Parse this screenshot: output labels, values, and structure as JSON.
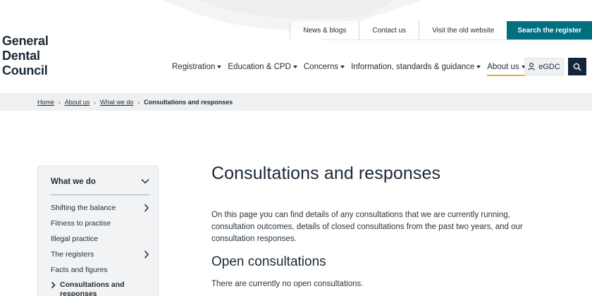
{
  "logo": {
    "line1": "General",
    "line2": "Dental",
    "line3": "Council"
  },
  "utility_nav": {
    "news": "News & blogs",
    "contact": "Contact us",
    "old_site": "Visit the old website",
    "search_register": "Search the register"
  },
  "main_nav": {
    "registration": "Registration",
    "education": "Education & CPD",
    "concerns": "Concerns",
    "info": "Information, standards & guidance",
    "about": "About us",
    "egdc": "eGDC"
  },
  "breadcrumb": {
    "home": "Home",
    "about": "About us",
    "what_we_do": "What we do",
    "current": "Consultations and responses"
  },
  "sidebar": {
    "heading": "What we do",
    "items": [
      "Shifting the balance",
      "Fitness to practise",
      "Illegal practice",
      "The registers",
      "Facts and figures"
    ],
    "current": "Consultations and responses"
  },
  "content": {
    "title": "Consultations and responses",
    "intro": "On this page you can find details of any consultations that we are currently running, consultation outcomes, details of closed consultations from the past two years, and our consultation responses.",
    "open_heading": "Open consultations",
    "open_text": "There are currently no open consultations."
  },
  "colors": {
    "brand_dark": "#12263a",
    "accent_teal": "#006f80",
    "active_underline": "#e8a93a"
  },
  "icons": [
    "user-icon",
    "search-icon",
    "caret-down-icon",
    "chevron-down-icon",
    "chevron-right-icon"
  ]
}
